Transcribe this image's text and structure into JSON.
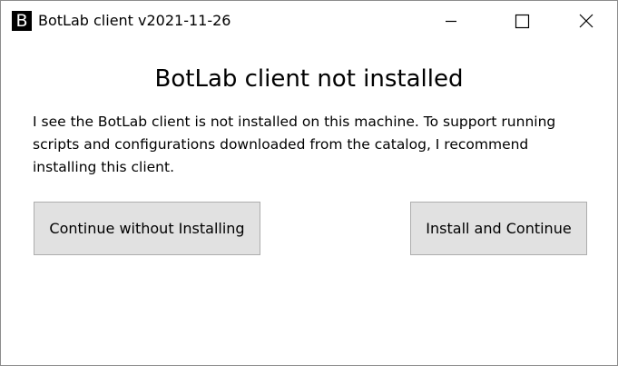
{
  "window": {
    "title": "BotLab client v2021-11-26",
    "icon_letter": "B",
    "icon": "botlab-app-icon",
    "caption_buttons": {
      "minimize_icon": "minimize-icon",
      "maximize_icon": "maximize-icon",
      "close_icon": "close-icon"
    }
  },
  "dialog": {
    "heading": "BotLab client not installed",
    "message": "I see the BotLab client is not installed on this machine. To support running scripts and configurations downloaded from the catalog, I recommend installing this client.",
    "buttons": {
      "continue_label": "Continue without Installing",
      "install_label": "Install and Continue"
    }
  },
  "colors": {
    "button_bg": "#e1e1e1",
    "button_border": "#adadad",
    "window_border": "#8c8c8c"
  }
}
